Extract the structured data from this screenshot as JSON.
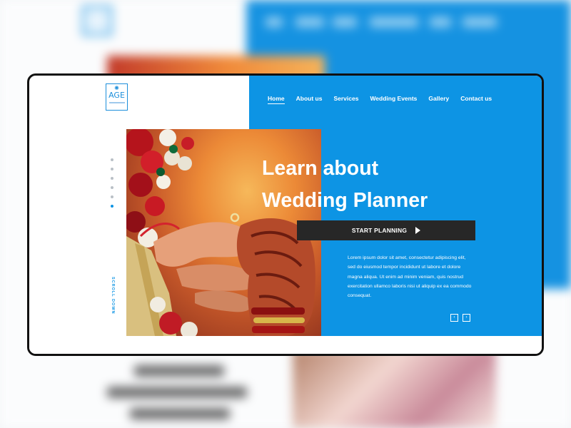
{
  "logo": {
    "text": "AGE",
    "icon": "sun-icon"
  },
  "nav": {
    "items": [
      {
        "label": "Home",
        "active": true
      },
      {
        "label": "About us",
        "active": false
      },
      {
        "label": "Services",
        "active": false
      },
      {
        "label": "Wedding Events",
        "active": false
      },
      {
        "label": "Gallery",
        "active": false
      },
      {
        "label": "Contact us",
        "active": false
      }
    ]
  },
  "hero": {
    "headline_line1": "Learn about",
    "headline_line2": "Wedding Planner",
    "cta_label": "START PLANNING",
    "body": "Lorem ipsum dolor sit amet, consectetur adipiscing elit, sed do eiusmod tempor incididunt ut labore et dolore magna aliqua. Ut enim ad minim veniam, quis nostrud exercitation ullamco laboris nisi ut aliquip ex ea commodo consequat.",
    "photo": "wedding-hands-photo"
  },
  "pagination": {
    "count": 6,
    "active_index": 5
  },
  "scroll_label": "SCROLL DOWN",
  "slider": {
    "prev": "‹",
    "next": "›"
  },
  "colors": {
    "accent": "#0d94e4",
    "button": "#272727",
    "page_bg": "#ffffff"
  }
}
